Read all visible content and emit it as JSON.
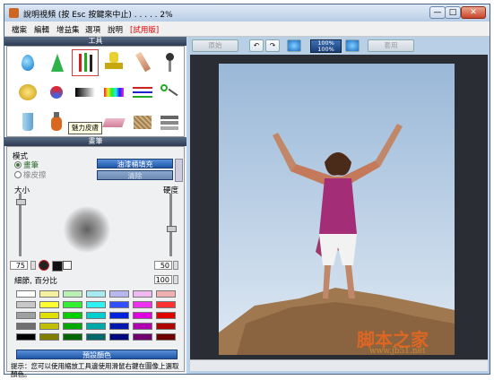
{
  "window": {
    "title": "說明視頻 (按 Esc 按鍵來中止) . . . . . 2%"
  },
  "window_controls": {
    "minimize": "—",
    "maximize": "□",
    "close": "✕"
  },
  "menu": [
    {
      "label": "檔案"
    },
    {
      "label": "編輯"
    },
    {
      "label": "增益集"
    },
    {
      "label": "選項"
    },
    {
      "label": "說明"
    },
    {
      "label": "[試用版]"
    }
  ],
  "tools_panel": {
    "title": "工具",
    "tooltip": "魅力皮膚"
  },
  "brush_panel": {
    "title": "畫筆",
    "mode_label": "模式",
    "mode_brush": "畫筆",
    "mode_eraser": "橡皮擦",
    "fill_button": "油漆桶填充",
    "clear_button": "清除",
    "size_label": "大小",
    "hardness_label": "硬度",
    "size_value": "75",
    "hardness_value": "50",
    "detail_label": "細節, 百分比",
    "detail_value": "100",
    "preset_button": "預設顏色",
    "hint": "提示：您可以使用縮放工具邊使用滑鼠右鍵在圖像上選取顏色。"
  },
  "palette": {
    "row1": [
      "#ffffff",
      "#f4f0a0",
      "#b8f0b8",
      "#a8e8f0",
      "#b8b8f0",
      "#f0b8f0",
      "#f0b0b0"
    ],
    "row2": [
      "#c8c8c8",
      "#ffff30",
      "#30f030",
      "#30f0f0",
      "#3050ff",
      "#f030f0",
      "#ff3030"
    ],
    "row3": [
      "#a0a0a0",
      "#e0e000",
      "#00d000",
      "#00d0d0",
      "#0020e0",
      "#e000e0",
      "#e00000"
    ],
    "row4": [
      "#707070",
      "#c0c000",
      "#00a800",
      "#00a8a8",
      "#0018b0",
      "#b000b0",
      "#b00000"
    ],
    "row5": [
      "#000000",
      "#808000",
      "#006800",
      "#006868",
      "#000880",
      "#700070",
      "#700000"
    ]
  },
  "toolbar": {
    "before_label": "原始",
    "after_label": "套用",
    "zoom_top": "100%",
    "zoom_bottom": "100%"
  },
  "watermark": {
    "line1": "脚本之家",
    "line2": "www.jb51.net"
  }
}
